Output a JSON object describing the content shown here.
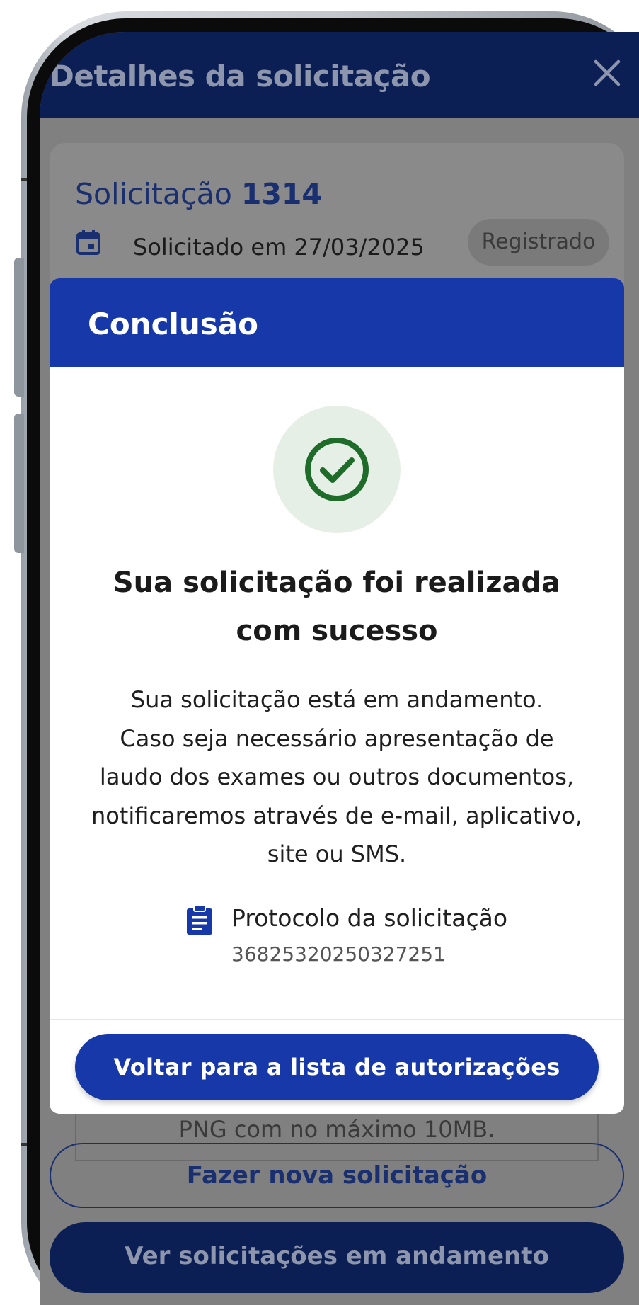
{
  "header": {
    "title": "Detalhes da solicitação",
    "close_icon": "close-icon"
  },
  "request_card": {
    "title_prefix": "Solicitação",
    "number": "1314",
    "date_text": "Solicitado em 27/03/2025",
    "status": "Registrado"
  },
  "background": {
    "upload_hint": "PNG com no máximo 10MB.",
    "new_request_label": "Fazer nova solicitação",
    "in_progress_label": "Ver solicitações em andamento"
  },
  "modal": {
    "title": "Conclusão",
    "heading_line1": "Sua solicitação foi realizada",
    "heading_line2": "com sucesso",
    "body_lines": [
      "Sua solicitação está em andamento.",
      "Caso seja necessário apresentação de",
      "laudo dos exames ou outros documentos,",
      "notificaremos através de e-mail, aplicativo,",
      "site ou SMS."
    ],
    "protocol_label": "Protocolo da solicitação",
    "protocol_number": "36825320250327251",
    "back_button_label": "Voltar para a lista de autorizações"
  },
  "colors": {
    "primary": "#1638a8",
    "header_dimmed": "#0c1f54",
    "success": "#1e6b2a",
    "success_bg": "#e6efe6"
  }
}
